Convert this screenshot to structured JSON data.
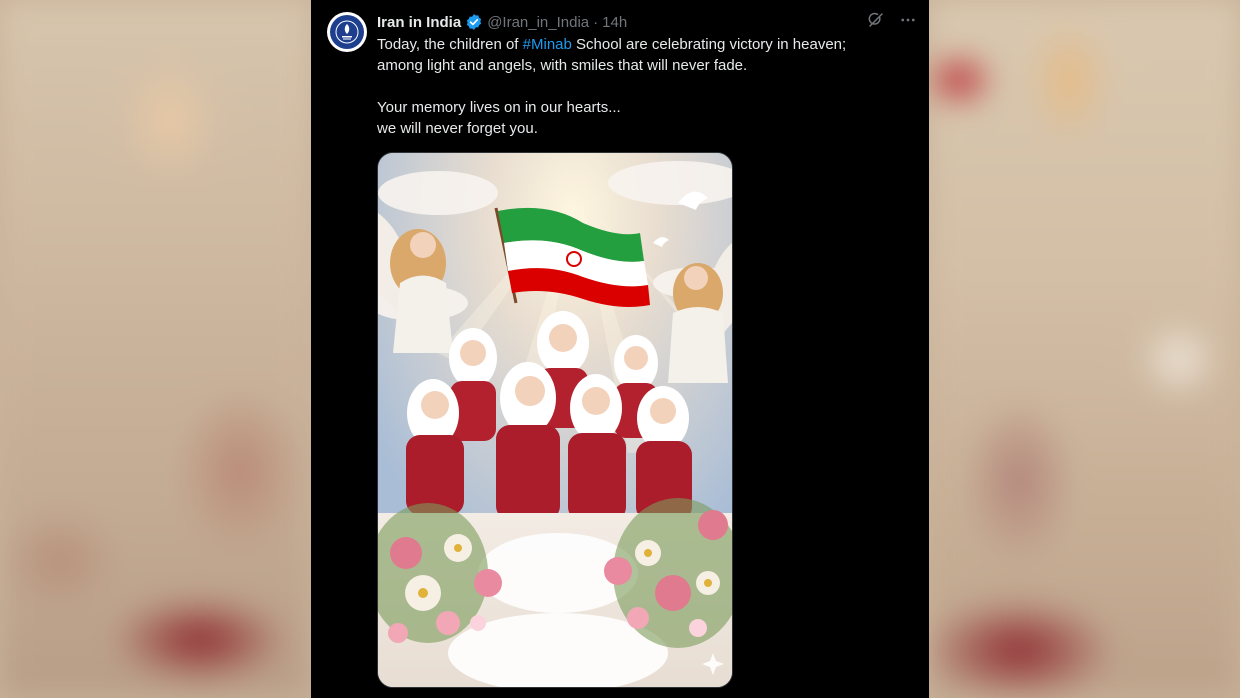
{
  "tweet": {
    "display_name": "Iran in India",
    "handle": "@Iran_in_India",
    "separator": "·",
    "time": "14h",
    "text_line1_before": "Today, the children of ",
    "hashtag": "#Minab",
    "text_line1_after": " School are celebrating victory in heaven;",
    "text_line2": "among light and angels, with smiles that will never fade.",
    "text_line3": "Your memory lives on in our hearts...",
    "text_line4": "we will never forget you.",
    "icons": {
      "verified": "verified-badge-icon",
      "grok": "grok-icon",
      "more": "more-icon"
    },
    "colors": {
      "link": "#1d9bf0",
      "verified": "#1d9bf0",
      "background": "#000000",
      "secondary_text": "#71767b"
    }
  }
}
